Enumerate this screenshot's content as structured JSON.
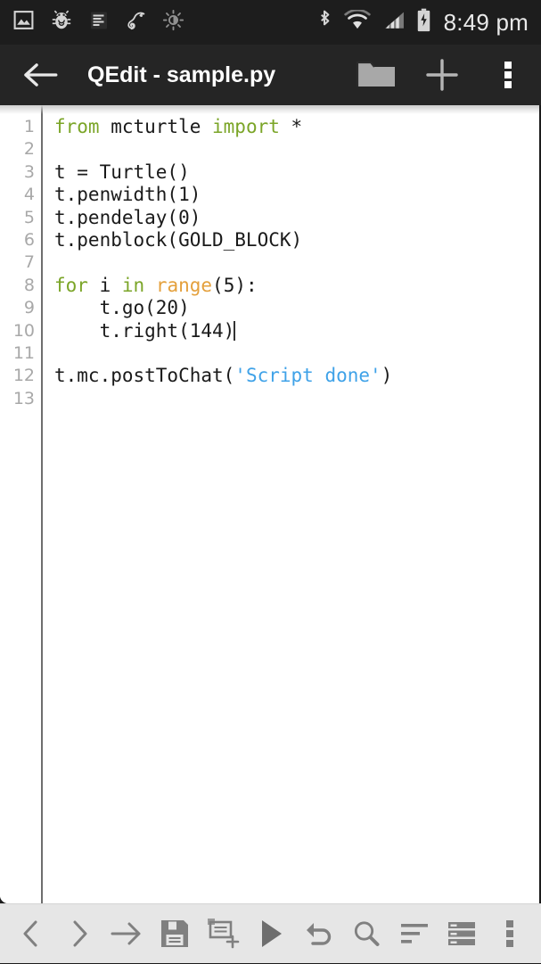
{
  "status_bar": {
    "left_icons": [
      {
        "name": "gallery-icon",
        "label": "Gallery"
      },
      {
        "name": "bug-icon",
        "label": "Debug"
      },
      {
        "name": "text-lines-icon",
        "label": "Notes"
      },
      {
        "name": "chameleon-icon",
        "label": "Chameleon"
      },
      {
        "name": "brightness-icon",
        "label": "Brightness"
      }
    ],
    "right_icons": [
      {
        "name": "bluetooth-icon",
        "label": "Bluetooth"
      },
      {
        "name": "wifi-icon",
        "label": "Wi-Fi"
      },
      {
        "name": "cell-signal-icon",
        "label": "Signal"
      },
      {
        "name": "battery-charging-icon",
        "label": "Battery charging"
      }
    ],
    "clock": "8:49 pm",
    "background": "#1d1d1d",
    "icon_color": "#d4d4d4"
  },
  "title_bar": {
    "back_label": "Back",
    "title": "QEdit - sample.py",
    "background": "#252525",
    "actions": [
      {
        "name": "open-folder-button",
        "label": "Open"
      },
      {
        "name": "new-file-button",
        "label": "New"
      },
      {
        "name": "overflow-menu-button",
        "label": "More options"
      }
    ]
  },
  "editor": {
    "gutter_line_numbers": [
      "1",
      "2",
      "3",
      "4",
      "5",
      "6",
      "7",
      "8",
      "9",
      "10",
      "11",
      "12",
      "13"
    ],
    "cursor_line": 10,
    "background": "#ffffff",
    "colors": {
      "keyword": "#7ba528",
      "function": "#e4a03c",
      "string": "#3fa2e8",
      "plain": "#1a1a1a",
      "line_number": "#a8a8a8"
    },
    "lines": [
      {
        "n": 1,
        "tokens": [
          {
            "t": "from ",
            "c": "kw"
          },
          {
            "t": "mcturtle ",
            "c": ""
          },
          {
            "t": "import",
            "c": "kw"
          },
          {
            "t": " *",
            "c": ""
          }
        ]
      },
      {
        "n": 2,
        "tokens": []
      },
      {
        "n": 3,
        "tokens": [
          {
            "t": "t = Turtle()",
            "c": ""
          }
        ]
      },
      {
        "n": 4,
        "tokens": [
          {
            "t": "t.penwidth(1)",
            "c": ""
          }
        ]
      },
      {
        "n": 5,
        "tokens": [
          {
            "t": "t.pendelay(0)",
            "c": ""
          }
        ]
      },
      {
        "n": 6,
        "tokens": [
          {
            "t": "t.penblock(GOLD_BLOCK)",
            "c": ""
          }
        ]
      },
      {
        "n": 7,
        "tokens": []
      },
      {
        "n": 8,
        "tokens": [
          {
            "t": "for",
            "c": "kw"
          },
          {
            "t": " i ",
            "c": ""
          },
          {
            "t": "in",
            "c": "kw"
          },
          {
            "t": " ",
            "c": ""
          },
          {
            "t": "range",
            "c": "fn"
          },
          {
            "t": "(5):",
            "c": ""
          }
        ]
      },
      {
        "n": 9,
        "tokens": [
          {
            "t": "    t.go(20)",
            "c": ""
          }
        ]
      },
      {
        "n": 10,
        "tokens": [
          {
            "t": "    t.right(144)",
            "c": ""
          }
        ],
        "caret": true
      },
      {
        "n": 11,
        "tokens": []
      },
      {
        "n": 12,
        "tokens": [
          {
            "t": "t.mc.postToChat(",
            "c": ""
          },
          {
            "t": "'Script done'",
            "c": "str"
          },
          {
            "t": ")",
            "c": ""
          }
        ]
      },
      {
        "n": 13,
        "tokens": []
      }
    ],
    "plain_text": "from mcturtle import *\n\nt = Turtle()\nt.penwidth(1)\nt.pendelay(0)\nt.penblock(GOLD_BLOCK)\n\nfor i in range(5):\n    t.go(20)\n    t.right(144)\n\nt.mc.postToChat('Script done')\n"
  },
  "bottom_bar": {
    "background": "#e6e6e6",
    "icon_color": "#808080",
    "buttons": [
      {
        "name": "prev-button",
        "label": "Previous"
      },
      {
        "name": "next-button",
        "label": "Next"
      },
      {
        "name": "tab-insert-button",
        "label": "Insert tab"
      },
      {
        "name": "save-button",
        "label": "Save"
      },
      {
        "name": "save-as-button",
        "label": "Save as"
      },
      {
        "name": "run-button",
        "label": "Run"
      },
      {
        "name": "undo-button",
        "label": "Undo"
      },
      {
        "name": "search-button",
        "label": "Search"
      },
      {
        "name": "format-button",
        "label": "Format"
      },
      {
        "name": "list-button",
        "label": "List"
      },
      {
        "name": "more-button",
        "label": "More"
      }
    ]
  }
}
